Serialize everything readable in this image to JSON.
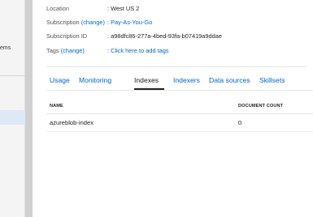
{
  "left_nav": {
    "fragment": "ems"
  },
  "properties": {
    "location": {
      "label": "Location",
      "value": ": West US 2"
    },
    "subscription": {
      "label": "Subscription",
      "change": "(change)",
      "value": "Pay-As-You-Go"
    },
    "subscription_id": {
      "label": "Subscription ID",
      "value": ": a98dfc86-277a-4bed-93fa-b07419a9ddae"
    },
    "tags": {
      "label": "Tags",
      "change": "(change)",
      "value": "Click here to add tags"
    }
  },
  "tabs": [
    {
      "label": "Usage",
      "active": false
    },
    {
      "label": "Monitoring",
      "active": false
    },
    {
      "label": "Indexes",
      "active": true
    },
    {
      "label": "Indexers",
      "active": false
    },
    {
      "label": "Data sources",
      "active": false
    },
    {
      "label": "Skillsets",
      "active": false
    }
  ],
  "indexes_table": {
    "columns": [
      "NAME",
      "DOCUMENT COUNT"
    ],
    "rows": [
      {
        "name": "azureblob-index",
        "document_count": "0"
      }
    ]
  },
  "colors": {
    "link": "#0066cc",
    "gutter": "#d0d0d0",
    "selected_nav": "#dfe9f6"
  }
}
